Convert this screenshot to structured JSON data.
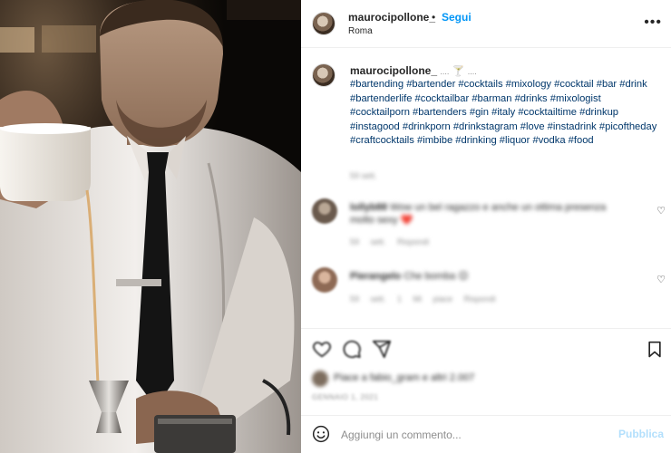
{
  "post": {
    "username": "maurocipollone_",
    "follow_label": "Segui",
    "separator": "•",
    "location": "Roma",
    "more_icon": "more-horizontal-icon"
  },
  "caption": {
    "username": "maurocipollone_",
    "suffix": "....",
    "emoji": "🍸",
    "emoji_suffix": "....",
    "hashtags": "#bartending #bartender #cocktails #mixology #cocktail #bar #drink #bartenderlife #cocktailbar #barman #drinks #mixologist #cocktailporn #bartenders #gin #italy #cocktailtime #drinkup #instagood #drinkporn #drinkstagram #love #instadrink #picoftheday #craftcocktails #imbibe #drinking #liquor #vodka #food",
    "time": "59 sett."
  },
  "comments": [
    {
      "username": "lollyb88",
      "text": "Wow un bel ragazzo e anche un ottima presenza molto sexy ❤️",
      "meta": "59 sett. Rispondi"
    },
    {
      "username": "Pierangelo",
      "text": "Che bomba 😊",
      "meta": "59 sett. 1 Mi piace Rispondi"
    }
  ],
  "actions": {
    "like_icon": "heart-icon",
    "comment_icon": "comment-icon",
    "share_icon": "share-icon",
    "save_icon": "bookmark-icon"
  },
  "likes": {
    "text": "Piace a fabio_gram e altri 2.007"
  },
  "date": "GENNAIO 1, 2021",
  "add_comment": {
    "placeholder": "Aggiungi un commento...",
    "publish_label": "Pubblica"
  },
  "colors": {
    "link": "#00376b",
    "follow": "#0095f6",
    "publish_disabled": "#b2dffc",
    "photo_bg": "#0c0a08"
  }
}
